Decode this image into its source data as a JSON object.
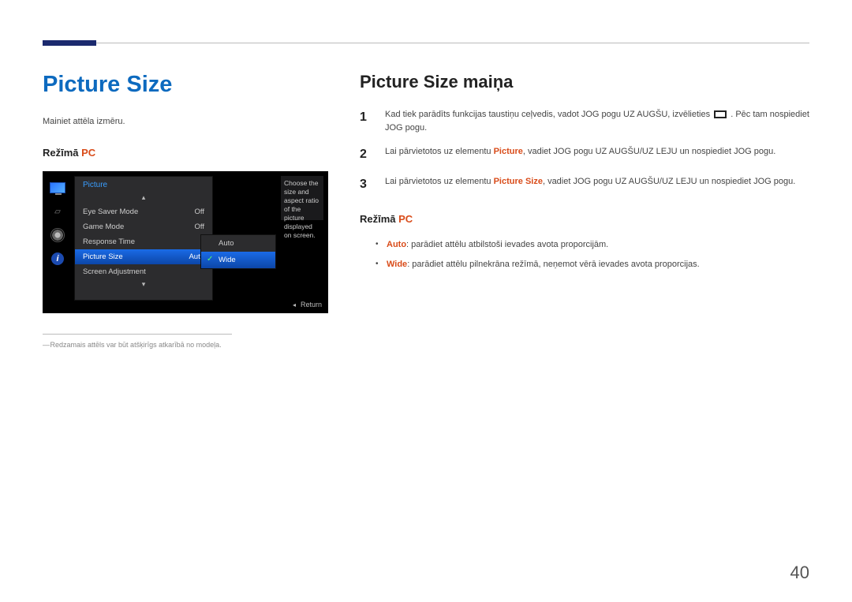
{
  "page_number": "40",
  "left": {
    "heading": "Picture Size",
    "intro": "Mainiet attēla izmēru.",
    "mode_label": "Režīmā ",
    "mode_tag": "PC",
    "footnote": "Redzamais attēls var būt atšķirīgs atkarībā no modeļa."
  },
  "osd": {
    "panel_title": "Picture",
    "rows": [
      {
        "label": "Eye Saver Mode",
        "value": "Off"
      },
      {
        "label": "Game Mode",
        "value": "Off"
      },
      {
        "label": "Response Time",
        "value": ""
      },
      {
        "label": "Picture Size",
        "value": "Auto",
        "selected": true
      },
      {
        "label": "Screen Adjustment",
        "value": ""
      }
    ],
    "submenu": [
      {
        "label": "Auto"
      },
      {
        "label": "Wide",
        "selected": true
      }
    ],
    "help_text": "Choose the size and aspect ratio of the picture displayed on screen.",
    "return_label": "Return",
    "updown_up": "▴",
    "updown_down": "▾"
  },
  "right": {
    "heading": "Picture Size maiņa",
    "steps": [
      {
        "num": "1",
        "pre": "Kad tiek parādīts funkcijas taustiņu ceļvedis, vadot JOG pogu UZ AUGŠU, izvēlieties ",
        "post": " Pēc tam nospiediet JOG pogu."
      },
      {
        "num": "2",
        "pre": "Lai pārvietotos uz elementu ",
        "bold_red": "Picture",
        "post": ", vadiet JOG pogu UZ AUGŠU/UZ LEJU un nospiediet JOG pogu."
      },
      {
        "num": "3",
        "pre": "Lai pārvietotos uz elementu ",
        "bold_red": "Picture Size",
        "post": ", vadiet JOG pogu UZ AUGŠU/UZ LEJU un nospiediet JOG pogu."
      }
    ],
    "mode_label": "Režīmā ",
    "mode_tag": "PC",
    "bullets": [
      {
        "lead": "Auto",
        "text": ": parādiet attēlu atbilstoši ievades avota proporcijām."
      },
      {
        "lead": "Wide",
        "text": ": parādiet attēlu pilnekrāna režīmā, neņemot vērā ievades avota proporcijas."
      }
    ]
  }
}
